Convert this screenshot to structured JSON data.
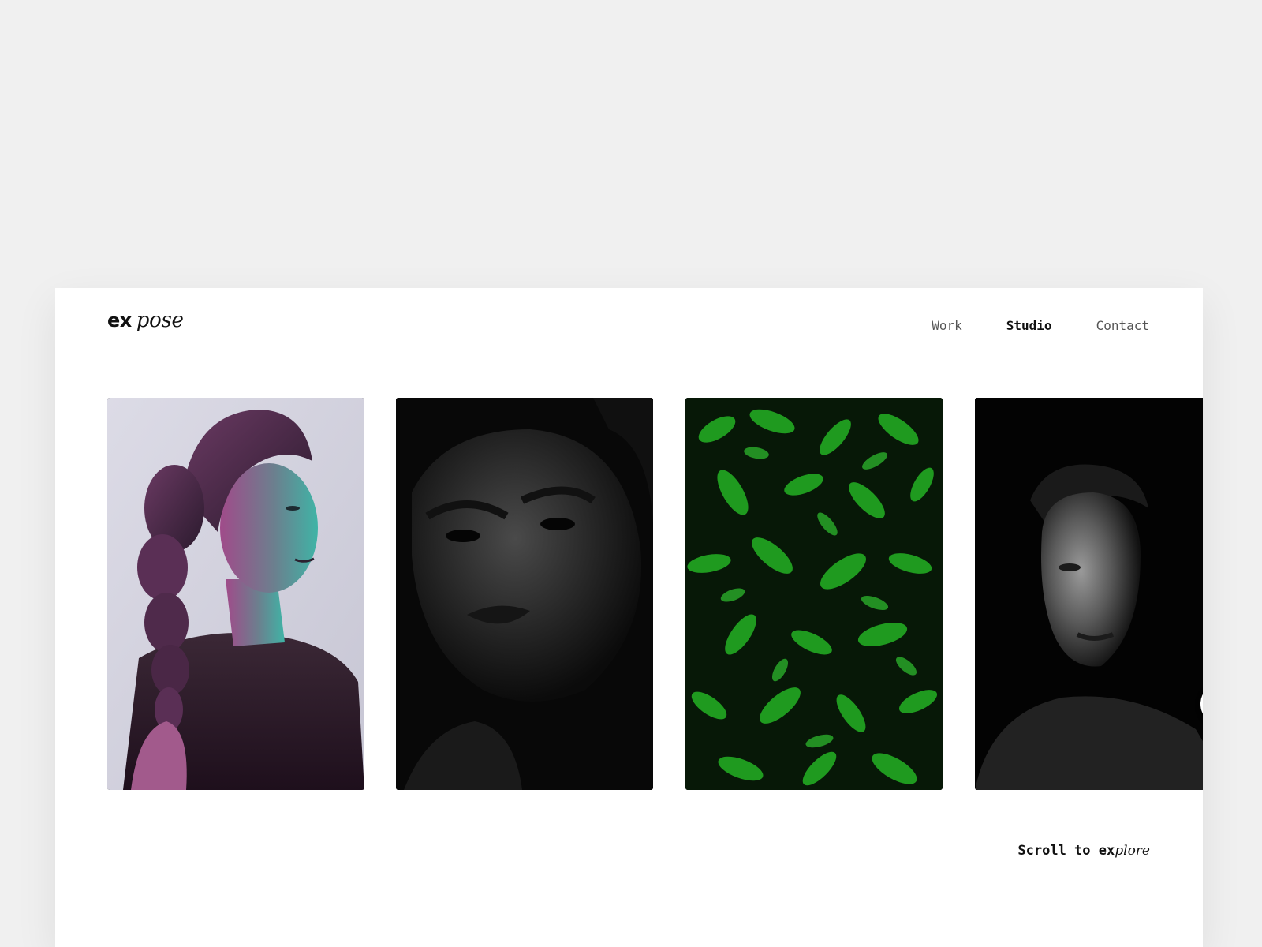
{
  "logo": {
    "part1": "ex",
    "part2": "pose"
  },
  "nav": {
    "items": [
      {
        "label": "Work",
        "active": false
      },
      {
        "label": "Studio",
        "active": true
      },
      {
        "label": "Contact",
        "active": false
      }
    ]
  },
  "gallery": {
    "cards": [
      {
        "subject": "portrait-woman-teal-magenta"
      },
      {
        "subject": "portrait-woman-dark"
      },
      {
        "subject": "green-leaves"
      },
      {
        "subject": "portrait-man-dark"
      }
    ],
    "next_icon": "chevron-right-icon"
  },
  "footer": {
    "scroll_prefix": "Scroll to ",
    "scroll_bold": "ex",
    "scroll_italic": "plore"
  },
  "colors": {
    "background": "#f0f0f0",
    "surface": "#ffffff",
    "text": "#111111",
    "muted": "#555555",
    "leaf_green": "#1f9a1f"
  }
}
